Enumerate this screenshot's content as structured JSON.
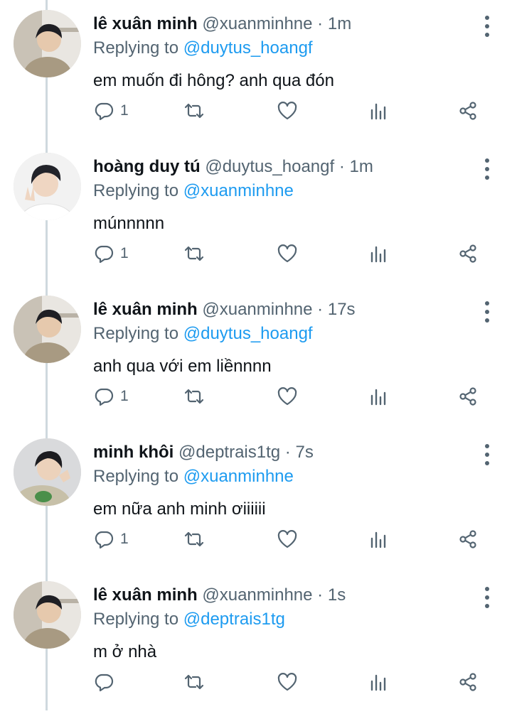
{
  "replying_prefix": "Replying to",
  "tweets": [
    {
      "name": "lê xuân minh",
      "handle": "@xuanminhne",
      "time": "1m",
      "reply_to": "@duytus_hoangf",
      "text": "em muốn đi hông? anh qua đón",
      "reply_count": "1"
    },
    {
      "name": "hoàng duy tú",
      "handle": "@duytus_hoangf",
      "time": "1m",
      "reply_to": "@xuanminhne",
      "text": "múnnnnn",
      "reply_count": "1"
    },
    {
      "name": "lê xuân minh",
      "handle": "@xuanminhne",
      "time": "17s",
      "reply_to": "@duytus_hoangf",
      "text": "anh qua với em liềnnnn",
      "reply_count": "1"
    },
    {
      "name": "minh khôi",
      "handle": "@deptrais1tg",
      "time": "7s",
      "reply_to": "@xuanminhne",
      "text": "em nữa anh minh ơiiiiii",
      "reply_count": "1"
    },
    {
      "name": "lê xuân minh",
      "handle": "@xuanminhne",
      "time": "1s",
      "reply_to": "@deptrais1tg",
      "text": "m ở nhà",
      "reply_count": ""
    }
  ],
  "icons": [
    "reply-icon",
    "retweet-icon",
    "like-icon",
    "analytics-icon",
    "share-icon",
    "more-options-icon"
  ],
  "colors": {
    "link": "#1d9bf0",
    "muted": "#536471",
    "text": "#0f1419",
    "thread_line": "#cfd9de"
  }
}
